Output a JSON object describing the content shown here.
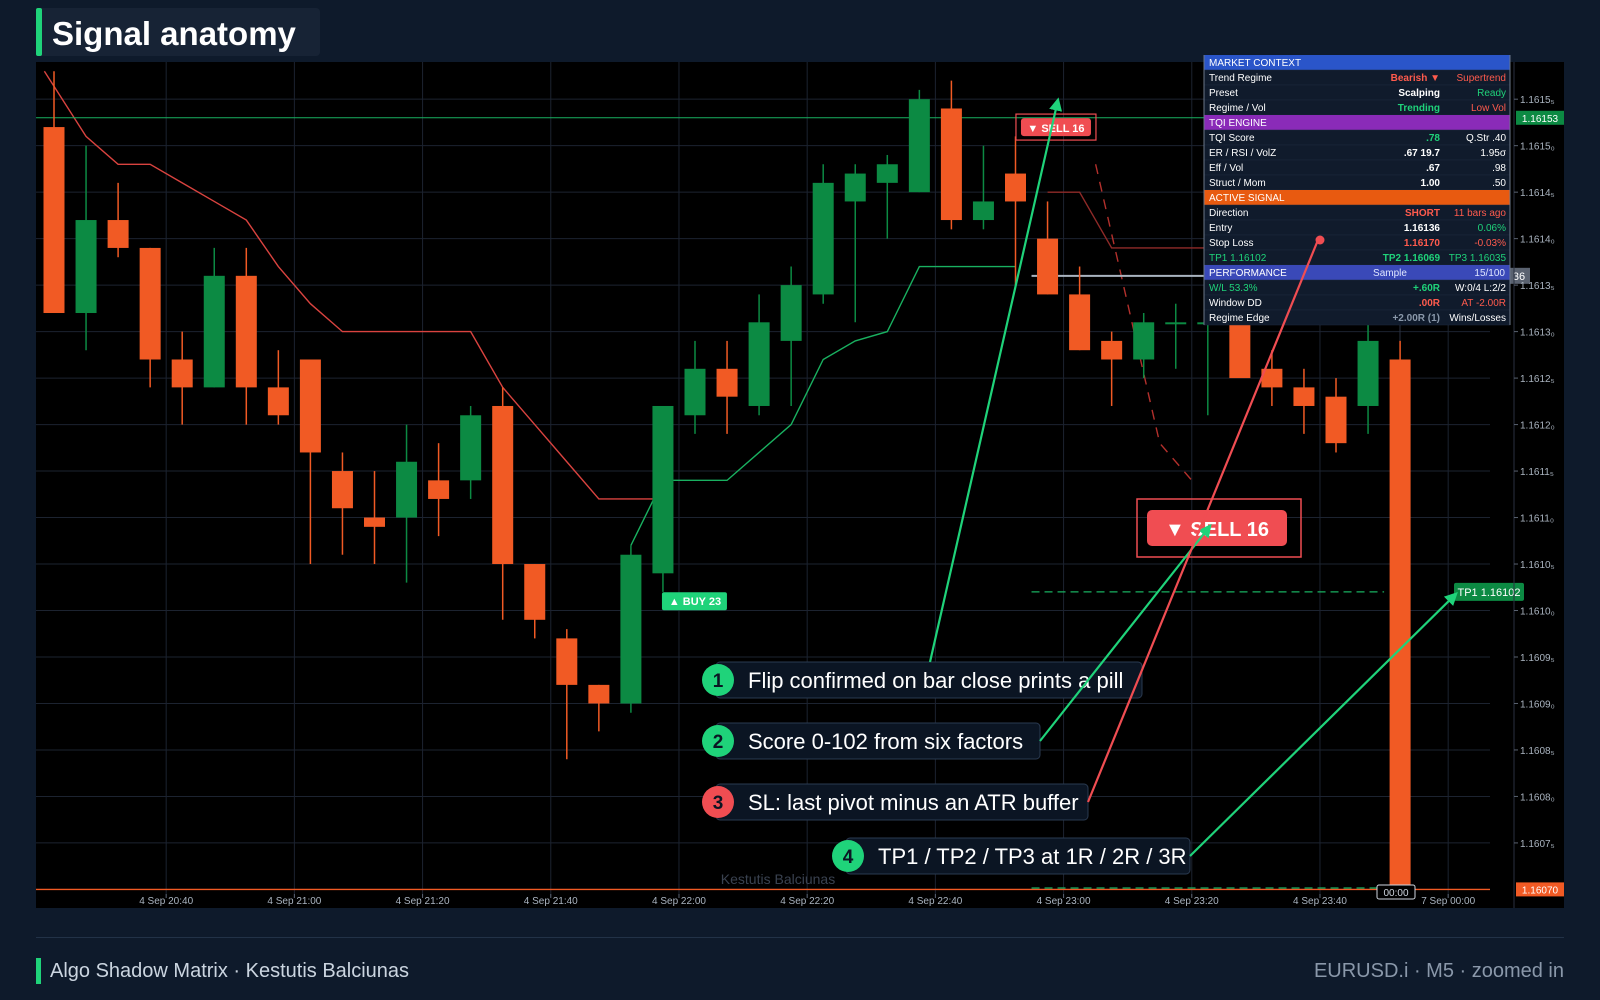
{
  "title": "Signal anatomy",
  "footer": {
    "left": "Algo Shadow Matrix · Kestutis Balciunas",
    "right": "EURUSD.i · M5 · zoomed in"
  },
  "colors": {
    "bull": "#0c8a43",
    "bear": "#f15a24",
    "accent": "#1fd37a",
    "danger": "#f04d52",
    "background": "#0e1a2b",
    "plot": "#000000"
  },
  "chart_data": {
    "type": "candlestick",
    "ylim": [
      1.16068,
      1.16159
    ],
    "y_ticks": [
      "1.1615₅",
      "1.1615₀",
      "1.1614₅",
      "1.1614₀",
      "1.1613₅",
      "1.1613₀",
      "1.1612₅",
      "1.1612₀",
      "1.1611₅",
      "1.1611₀",
      "1.1610₅",
      "1.1610₀",
      "1.1609₅",
      "1.1609₀",
      "1.1608₅",
      "1.1608₀",
      "1.1607₅"
    ],
    "y_tick_values": [
      1.16155,
      1.1615,
      1.16145,
      1.1614,
      1.16135,
      1.1613,
      1.16125,
      1.1612,
      1.16115,
      1.1611,
      1.16105,
      1.161,
      1.16095,
      1.1609,
      1.16085,
      1.1608,
      1.16075
    ],
    "x_labels": [
      "4 Sep 20:40",
      "4 Sep 21:00",
      "4 Sep 21:20",
      "4 Sep 21:40",
      "4 Sep 22:00",
      "4 Sep 22:20",
      "4 Sep 22:40",
      "4 Sep 23:00",
      "4 Sep 23:20",
      "4 Sep 23:40",
      "7 Sep 00:00"
    ],
    "x_label_bars": [
      3.5,
      7.5,
      11.5,
      15.5,
      19.5,
      23.5,
      27.5,
      31.5,
      35.5,
      39.5,
      43.5
    ],
    "candles": [
      {
        "o": 1.16152,
        "h": 1.16158,
        "l": 1.16132,
        "c": 1.16132
      },
      {
        "o": 1.16132,
        "h": 1.1615,
        "l": 1.16128,
        "c": 1.16142
      },
      {
        "o": 1.16142,
        "h": 1.16146,
        "l": 1.16138,
        "c": 1.16139
      },
      {
        "o": 1.16139,
        "h": 1.16139,
        "l": 1.16124,
        "c": 1.16127
      },
      {
        "o": 1.16127,
        "h": 1.1613,
        "l": 1.1612,
        "c": 1.16124
      },
      {
        "o": 1.16124,
        "h": 1.16139,
        "l": 1.16124,
        "c": 1.16136
      },
      {
        "o": 1.16136,
        "h": 1.16139,
        "l": 1.1612,
        "c": 1.16124
      },
      {
        "o": 1.16124,
        "h": 1.16128,
        "l": 1.1612,
        "c": 1.16121
      },
      {
        "o": 1.16127,
        "h": 1.16127,
        "l": 1.16105,
        "c": 1.16117
      },
      {
        "o": 1.16115,
        "h": 1.16117,
        "l": 1.16106,
        "c": 1.16111
      },
      {
        "o": 1.1611,
        "h": 1.16115,
        "l": 1.16105,
        "c": 1.16109
      },
      {
        "o": 1.1611,
        "h": 1.1612,
        "l": 1.16103,
        "c": 1.16116
      },
      {
        "o": 1.16114,
        "h": 1.16118,
        "l": 1.16108,
        "c": 1.16112
      },
      {
        "o": 1.16114,
        "h": 1.16122,
        "l": 1.16112,
        "c": 1.16121
      },
      {
        "o": 1.16122,
        "h": 1.16124,
        "l": 1.16099,
        "c": 1.16105
      },
      {
        "o": 1.16105,
        "h": 1.16105,
        "l": 1.16097,
        "c": 1.16099
      },
      {
        "o": 1.16097,
        "h": 1.16098,
        "l": 1.16084,
        "c": 1.16092
      },
      {
        "o": 1.16092,
        "h": 1.16092,
        "l": 1.16087,
        "c": 1.1609
      },
      {
        "o": 1.1609,
        "h": 1.16107,
        "l": 1.16089,
        "c": 1.16106
      },
      {
        "o": 1.16104,
        "h": 1.16122,
        "l": 1.16102,
        "c": 1.16122
      },
      {
        "o": 1.16121,
        "h": 1.16129,
        "l": 1.16119,
        "c": 1.16126
      },
      {
        "o": 1.16126,
        "h": 1.16129,
        "l": 1.16119,
        "c": 1.16123
      },
      {
        "o": 1.16122,
        "h": 1.16134,
        "l": 1.16121,
        "c": 1.16131
      },
      {
        "o": 1.16129,
        "h": 1.16137,
        "l": 1.16122,
        "c": 1.16135
      },
      {
        "o": 1.16134,
        "h": 1.16148,
        "l": 1.16133,
        "c": 1.16146
      },
      {
        "o": 1.16144,
        "h": 1.16148,
        "l": 1.16131,
        "c": 1.16147
      },
      {
        "o": 1.16146,
        "h": 1.16149,
        "l": 1.1614,
        "c": 1.16148
      },
      {
        "o": 1.16145,
        "h": 1.16156,
        "l": 1.16145,
        "c": 1.16155
      },
      {
        "o": 1.16154,
        "h": 1.16157,
        "l": 1.16141,
        "c": 1.16142
      },
      {
        "o": 1.16142,
        "h": 1.1615,
        "l": 1.16141,
        "c": 1.16144
      },
      {
        "o": 1.16147,
        "h": 1.16151,
        "l": 1.16135,
        "c": 1.16144
      },
      {
        "o": 1.1614,
        "h": 1.16144,
        "l": 1.16134,
        "c": 1.16134
      },
      {
        "o": 1.16134,
        "h": 1.16137,
        "l": 1.16128,
        "c": 1.16128
      },
      {
        "o": 1.16129,
        "h": 1.1613,
        "l": 1.16122,
        "c": 1.16127
      },
      {
        "o": 1.16127,
        "h": 1.16132,
        "l": 1.16125,
        "c": 1.16131
      },
      {
        "o": 1.16131,
        "h": 1.16133,
        "l": 1.16126,
        "c": 1.16131
      },
      {
        "o": 1.16131,
        "h": 1.16134,
        "l": 1.16121,
        "c": 1.16131
      },
      {
        "o": 1.16131,
        "h": 1.16132,
        "l": 1.16128,
        "c": 1.16125
      },
      {
        "o": 1.16126,
        "h": 1.16128,
        "l": 1.16122,
        "c": 1.16124
      },
      {
        "o": 1.16124,
        "h": 1.16126,
        "l": 1.16119,
        "c": 1.16122
      },
      {
        "o": 1.16123,
        "h": 1.16125,
        "l": 1.16117,
        "c": 1.16118
      },
      {
        "o": 1.16122,
        "h": 1.16131,
        "l": 1.16119,
        "c": 1.16129
      },
      {
        "o": 1.16127,
        "h": 1.16129,
        "l": 1.16069,
        "c": 1.16069
      }
    ],
    "supertrend_bear": [
      [
        -0.3,
        1.16158
      ],
      [
        1,
        1.16151
      ],
      [
        2,
        1.16148
      ],
      [
        3,
        1.16148
      ],
      [
        4,
        1.16146
      ],
      [
        5,
        1.16144
      ],
      [
        6,
        1.16142
      ],
      [
        7,
        1.16137
      ],
      [
        8,
        1.16133
      ],
      [
        9,
        1.1613
      ],
      [
        10,
        1.1613
      ],
      [
        11,
        1.1613
      ],
      [
        12,
        1.1613
      ],
      [
        13,
        1.1613
      ],
      [
        14,
        1.16124
      ],
      [
        15,
        1.1612
      ],
      [
        16,
        1.16116
      ],
      [
        17,
        1.16112
      ],
      [
        18,
        1.16112
      ],
      [
        19,
        1.16112
      ]
    ],
    "supertrend_bull": [
      [
        18,
        1.16107
      ],
      [
        19,
        1.16114
      ],
      [
        20,
        1.16114
      ],
      [
        21,
        1.16114
      ],
      [
        22,
        1.16117
      ],
      [
        23,
        1.1612
      ],
      [
        24,
        1.16127
      ],
      [
        25,
        1.16129
      ],
      [
        26,
        1.1613
      ],
      [
        27,
        1.16137
      ],
      [
        28,
        1.16137
      ],
      [
        29,
        1.16137
      ],
      [
        30,
        1.16137
      ]
    ],
    "supertrend_bear2": [
      [
        31,
        1.16145
      ],
      [
        32,
        1.16145
      ],
      [
        33,
        1.16139
      ],
      [
        34,
        1.16139
      ],
      [
        35,
        1.16139
      ],
      [
        36,
        1.16139
      ],
      [
        37,
        1.16139
      ],
      [
        38,
        1.16135
      ],
      [
        39,
        1.16133
      ]
    ],
    "signals": [
      {
        "type": "sell",
        "label": "▼ SELL  16",
        "bar": 31.2,
        "price": 1.16152
      },
      {
        "type": "buy",
        "label": "▲ BUY  23",
        "bar": 19,
        "price": 1.16101
      }
    ],
    "levels": {
      "upper_marker": "1.16153",
      "upper_price": 1.16153,
      "lower_marker": "1.16070",
      "lower_price": 1.1607,
      "tp1_tag": "TP1 1.16102",
      "tp1_price": 1.16102,
      "mid_line": 1.16136,
      "mid_marker": "36",
      "bottom_tag": "00:00"
    },
    "zoom_label": "▼ SELL  16",
    "watermark": "Kestutis Balciunas",
    "callouts": [
      {
        "num": "1",
        "text": "Flip confirmed on bar close prints a pill",
        "kind": "good"
      },
      {
        "num": "2",
        "text": "Score 0-102 from six factors",
        "kind": "good"
      },
      {
        "num": "3",
        "text": "SL: last pivot minus an ATR buffer",
        "kind": "bad"
      },
      {
        "num": "4",
        "text": "TP1 / TP2 / TP3 at 1R / 2R / 3R",
        "kind": "good"
      }
    ],
    "panel": {
      "rows": [
        {
          "kind": "section",
          "label": "MARKET CONTEXT",
          "color": "#2a55c9"
        },
        {
          "kind": "row",
          "c": [
            [
              "Trend Regime",
              "#ffffff"
            ],
            [
              "Bearish ▼",
              "#ff5b4d"
            ],
            [
              "Supertrend",
              "#ff5b4d"
            ]
          ]
        },
        {
          "kind": "row",
          "c": [
            [
              "Preset",
              "#ffffff"
            ],
            [
              "Scalping",
              "#ffffff"
            ],
            [
              "Ready",
              "#1fd37a"
            ]
          ]
        },
        {
          "kind": "row",
          "c": [
            [
              "Regime / Vol",
              "#ffffff"
            ],
            [
              "Trending",
              "#1fd37a"
            ],
            [
              "Low Vol",
              "#ff5b4d"
            ]
          ]
        },
        {
          "kind": "section",
          "label": "TQI ENGINE",
          "color": "#8a2bb8"
        },
        {
          "kind": "row",
          "c": [
            [
              "TQI Score",
              "#ffffff"
            ],
            [
              ".78",
              "#1fd37a"
            ],
            [
              "Q.Str .40",
              "#ffffff"
            ]
          ]
        },
        {
          "kind": "row",
          "c": [
            [
              "ER / RSI / VolZ",
              "#ffffff"
            ],
            [
              ".67  19.7",
              "#ffffff"
            ],
            [
              "1.95σ",
              "#ffffff"
            ]
          ]
        },
        {
          "kind": "row",
          "c": [
            [
              "Eff / Vol",
              "#ffffff"
            ],
            [
              ".67",
              "#ffffff"
            ],
            [
              ".98",
              "#ffffff"
            ]
          ]
        },
        {
          "kind": "row",
          "c": [
            [
              "Struct / Mom",
              "#ffffff"
            ],
            [
              "1.00",
              "#ffffff"
            ],
            [
              ".50",
              "#ffffff"
            ]
          ]
        },
        {
          "kind": "section",
          "label": "ACTIVE SIGNAL",
          "color": "#e85a10"
        },
        {
          "kind": "row",
          "c": [
            [
              "Direction",
              "#ffffff"
            ],
            [
              "SHORT",
              "#ff5b4d"
            ],
            [
              "11 bars ago",
              "#ff5b4d"
            ]
          ]
        },
        {
          "kind": "row",
          "c": [
            [
              "Entry",
              "#ffffff"
            ],
            [
              "1.16136",
              "#ffffff"
            ],
            [
              "0.06%",
              "#1fd37a"
            ]
          ]
        },
        {
          "kind": "row",
          "c": [
            [
              "Stop Loss",
              "#ffffff"
            ],
            [
              "1.16170",
              "#ff5b4d"
            ],
            [
              "-0.03%",
              "#ff5b4d"
            ]
          ]
        },
        {
          "kind": "row",
          "c": [
            [
              "TP1 1.16102",
              "#1fd37a"
            ],
            [
              "TP2 1.16069",
              "#1fd37a"
            ],
            [
              "TP3 1.16035",
              "#1fd37a"
            ]
          ]
        },
        {
          "kind": "section",
          "label": "PERFORMANCE",
          "color": "#3a49b8",
          "c2": "Sample",
          "c3": "15/100"
        },
        {
          "kind": "row",
          "c": [
            [
              "W/L  53.3%",
              "#1fd37a"
            ],
            [
              "+.60R",
              "#1fd37a"
            ],
            [
              "W:0/4 L:2/2",
              "#ffffff"
            ]
          ]
        },
        {
          "kind": "row",
          "c": [
            [
              "Window DD",
              "#ffffff"
            ],
            [
              ".00R",
              "#ff5b4d"
            ],
            [
              "AT -2.00R",
              "#ff5b4d"
            ]
          ]
        },
        {
          "kind": "row",
          "c": [
            [
              "Regime Edge",
              "#ffffff"
            ],
            [
              "+2.00R (1)",
              "#8a98aa"
            ],
            [
              "Wins/Losses",
              "#ffffff"
            ]
          ]
        }
      ]
    }
  }
}
